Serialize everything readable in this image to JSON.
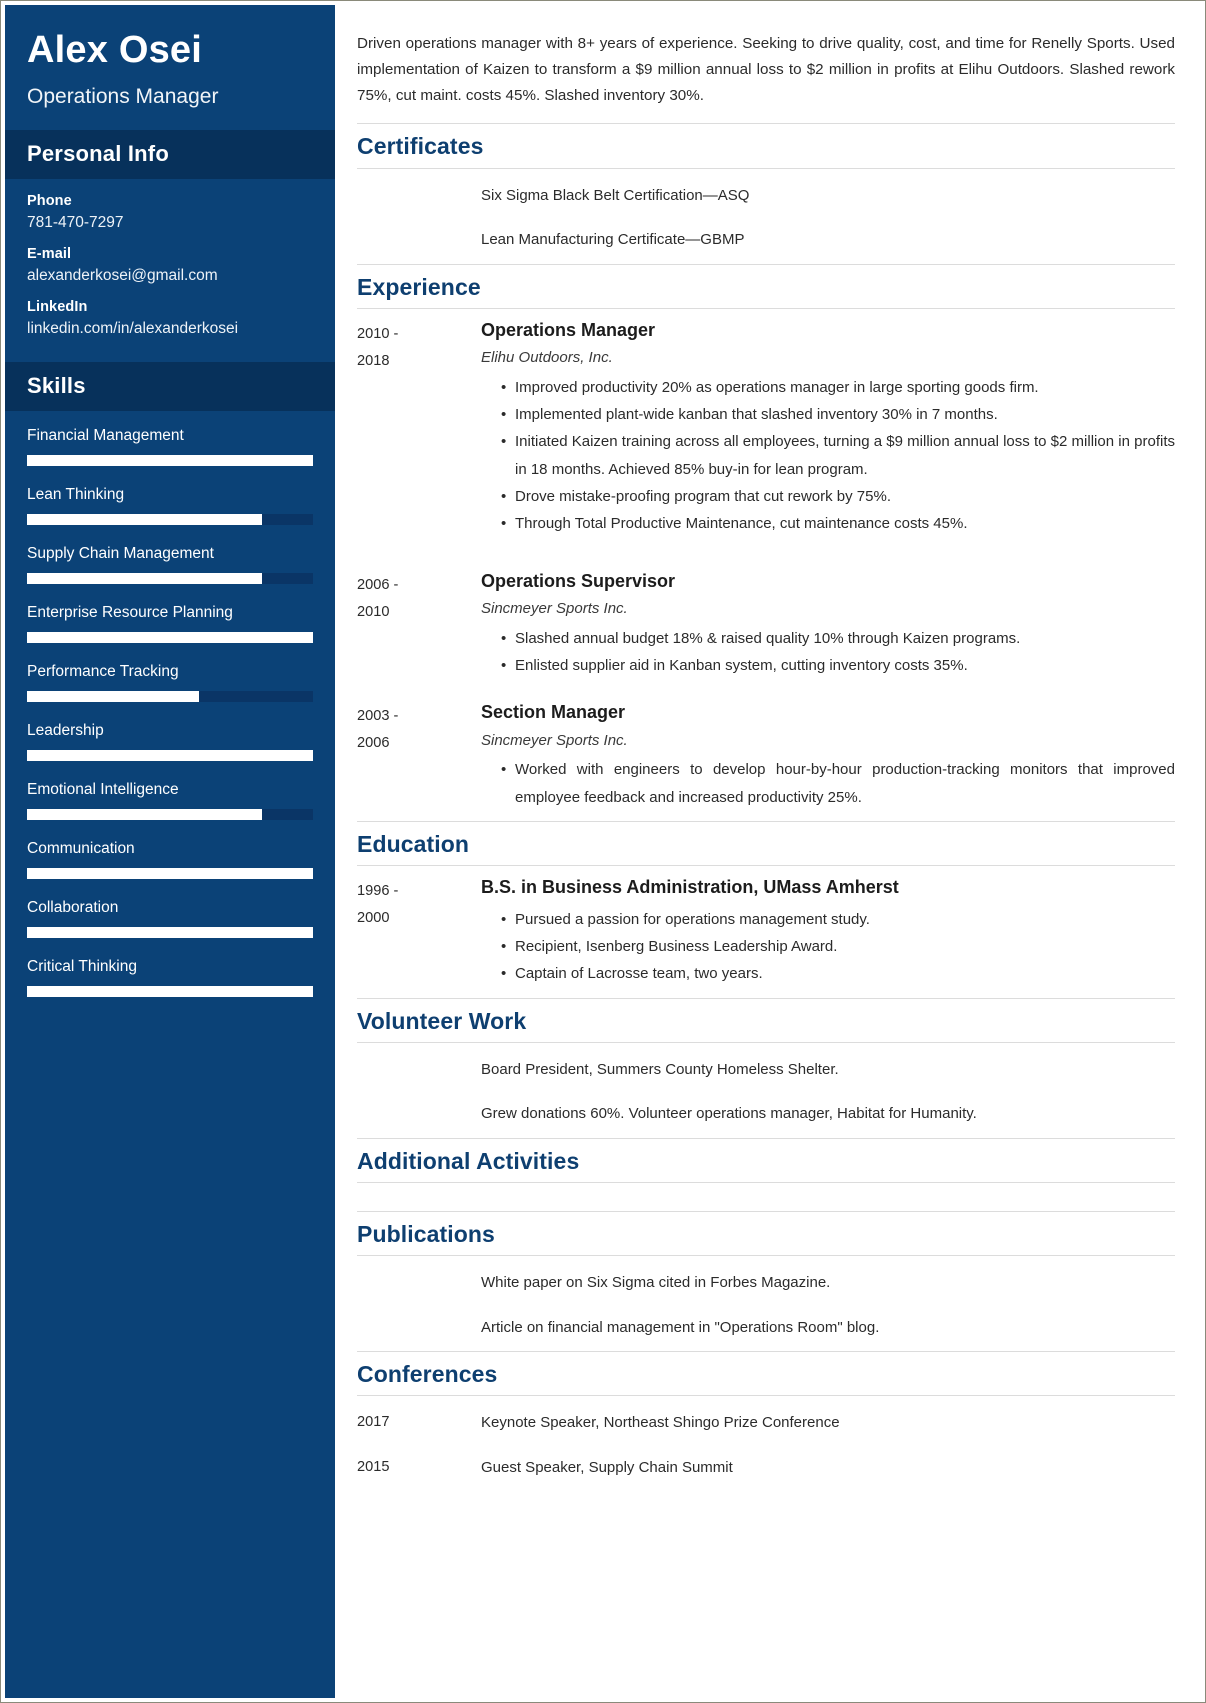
{
  "sidebar": {
    "full_name": "Alex Osei",
    "job_title": "Operations Manager",
    "personal_info_heading": "Personal Info",
    "contacts": [
      {
        "label": "Phone",
        "value": "781-470-7297"
      },
      {
        "label": "E-mail",
        "value": "alexanderkosei@gmail.com"
      },
      {
        "label": "LinkedIn",
        "value": "linkedin.com/in/alexanderkosei"
      }
    ],
    "skills_heading": "Skills",
    "skills": [
      {
        "name": "Financial Management",
        "level": 100
      },
      {
        "name": "Lean Thinking",
        "level": 82
      },
      {
        "name": "Supply Chain Management",
        "level": 82
      },
      {
        "name": "Enterprise Resource Planning",
        "level": 100
      },
      {
        "name": "Performance Tracking",
        "level": 60
      },
      {
        "name": "Leadership",
        "level": 100
      },
      {
        "name": "Emotional Intelligence",
        "level": 82
      },
      {
        "name": "Communication",
        "level": 100
      },
      {
        "name": "Collaboration",
        "level": 100
      },
      {
        "name": "Critical Thinking",
        "level": 100
      }
    ]
  },
  "main": {
    "summary": "Driven operations manager with 8+ years of experience. Seeking to drive quality, cost, and time for Renelly Sports. Used implementation of Kaizen to transform a $9 million annual loss to $2 million in profits at Elihu Outdoors. Slashed rework 75%, cut maint. costs 45%. Slashed inventory 30%.",
    "certificates": {
      "heading": "Certificates",
      "items": [
        "Six Sigma Black Belt Certification—ASQ",
        "Lean Manufacturing Certificate—GBMP"
      ]
    },
    "experience": {
      "heading": "Experience",
      "jobs": [
        {
          "date_start": "2010 -",
          "date_end": "2018",
          "title": "Operations Manager",
          "company": "Elihu Outdoors, Inc.",
          "bullets": [
            "Improved productivity 20% as operations manager in large sporting goods firm.",
            "Implemented plant-wide kanban that slashed inventory 30% in 7 months.",
            "Initiated Kaizen training across all employees, turning a $9 million annual loss to $2 million in profits in 18 months. Achieved 85% buy-in for lean program.",
            "Drove mistake-proofing program that cut rework by 75%.",
            "Through Total Productive Maintenance, cut maintenance costs 45%."
          ]
        },
        {
          "date_start": "2006 -",
          "date_end": "2010",
          "title": "Operations Supervisor",
          "company": "Sincmeyer Sports Inc.",
          "bullets": [
            "Slashed annual budget 18% & raised quality 10% through Kaizen programs.",
            "Enlisted supplier aid in Kanban system, cutting inventory costs 35%."
          ]
        },
        {
          "date_start": "2003 -",
          "date_end": "2006",
          "title": "Section Manager",
          "company": "Sincmeyer Sports Inc.",
          "bullets": [
            "Worked with engineers to develop hour-by-hour production-tracking monitors that improved employee feedback and increased productivity 25%."
          ]
        }
      ]
    },
    "education": {
      "heading": "Education",
      "entries": [
        {
          "date_start": "1996 -",
          "date_end": "2000",
          "title": "B.S. in Business Administration, UMass Amherst",
          "bullets": [
            "Pursued a passion for operations management study.",
            "Recipient, Isenberg Business Leadership Award.",
            "Captain of Lacrosse team, two years."
          ]
        }
      ]
    },
    "volunteer": {
      "heading": "Volunteer Work",
      "items": [
        "Board President, Summers County Homeless Shelter.",
        "Grew donations 60%. Volunteer operations manager, Habitat for Humanity."
      ]
    },
    "additional_activities": {
      "heading": "Additional Activities",
      "items": []
    },
    "publications": {
      "heading": "Publications",
      "items": [
        "White paper on Six Sigma cited in Forbes Magazine.",
        "Article on financial management in \"Operations Room\" blog."
      ]
    },
    "conferences": {
      "heading": "Conferences",
      "entries": [
        {
          "year": "2017",
          "text": "Keynote Speaker, Northeast Shingo Prize Conference"
        },
        {
          "year": "2015",
          "text": "Guest Speaker, Supply Chain Summit"
        }
      ]
    }
  },
  "colors": {
    "sidebar_bg": "#0b4277",
    "sidebar_head_bg": "#07315b",
    "accent_heading": "#0e3f70",
    "skill_track": "#0a3566",
    "skill_fill": "#ffffff"
  }
}
